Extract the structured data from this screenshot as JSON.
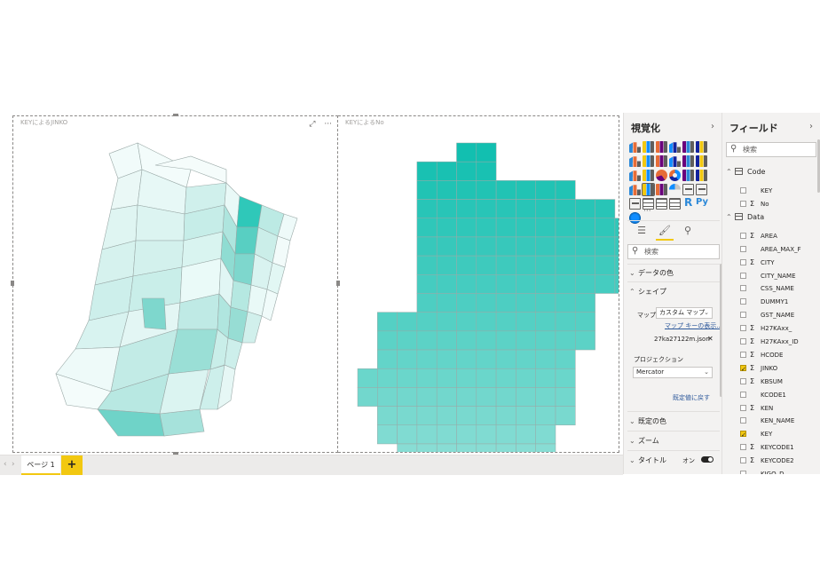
{
  "canvas": {
    "visual1": {
      "title": "KEYによるJINKO"
    },
    "visual2": {
      "title": "KEYによるNo"
    },
    "colors": {
      "dark": "#12bfb0",
      "light": "#eefaf9",
      "grid": "#9aa9a7"
    }
  },
  "tabs": {
    "page1": "ページ 1",
    "add": "+",
    "prev": "‹",
    "next": "›"
  },
  "viz_pane": {
    "title": "視覚化",
    "collapse_icon": "chevron-right-icon",
    "more": "···",
    "search_placeholder": "検索",
    "sections": {
      "data_colors": "データの色",
      "shape": "シェイプ",
      "default_colors": "既定の色",
      "zoom": "ズーム",
      "title": "タイトル"
    },
    "map_label": "マップ",
    "map_value": "カスタム マップ",
    "map_keys_link": "マップ キーの表示...",
    "map_file": "27ka27122m.json",
    "projection_label": "プロジェクション",
    "projection_value": "Mercator",
    "reset_default": "既定値に戻す",
    "title_toggle": "オン"
  },
  "fields_pane": {
    "title": "フィールド",
    "search_placeholder": "検索",
    "tables": [
      {
        "name": "Code",
        "fields": [
          {
            "name": "KEY",
            "sigma": false,
            "checked": false
          },
          {
            "name": "No",
            "sigma": true,
            "checked": false
          }
        ]
      },
      {
        "name": "Data",
        "fields": [
          {
            "name": "AREA",
            "sigma": true,
            "checked": false
          },
          {
            "name": "AREA_MAX_F",
            "sigma": false,
            "checked": false
          },
          {
            "name": "CITY",
            "sigma": true,
            "checked": false
          },
          {
            "name": "CITY_NAME",
            "sigma": false,
            "checked": false
          },
          {
            "name": "CSS_NAME",
            "sigma": false,
            "checked": false
          },
          {
            "name": "DUMMY1",
            "sigma": false,
            "checked": false
          },
          {
            "name": "GST_NAME",
            "sigma": false,
            "checked": false
          },
          {
            "name": "H27KAxx_",
            "sigma": true,
            "checked": false
          },
          {
            "name": "H27KAxx_ID",
            "sigma": true,
            "checked": false
          },
          {
            "name": "HCODE",
            "sigma": true,
            "checked": false
          },
          {
            "name": "JINKO",
            "sigma": true,
            "checked": true
          },
          {
            "name": "KBSUM",
            "sigma": true,
            "checked": false
          },
          {
            "name": "KCODE1",
            "sigma": false,
            "checked": false
          },
          {
            "name": "KEN",
            "sigma": true,
            "checked": false
          },
          {
            "name": "KEN_NAME",
            "sigma": false,
            "checked": false
          },
          {
            "name": "KEY",
            "sigma": false,
            "checked": true
          },
          {
            "name": "KEYCODE1",
            "sigma": true,
            "checked": false
          },
          {
            "name": "KEYCODE2",
            "sigma": true,
            "checked": false
          },
          {
            "name": "KIGO_D",
            "sigma": false,
            "checked": false
          }
        ]
      }
    ]
  }
}
